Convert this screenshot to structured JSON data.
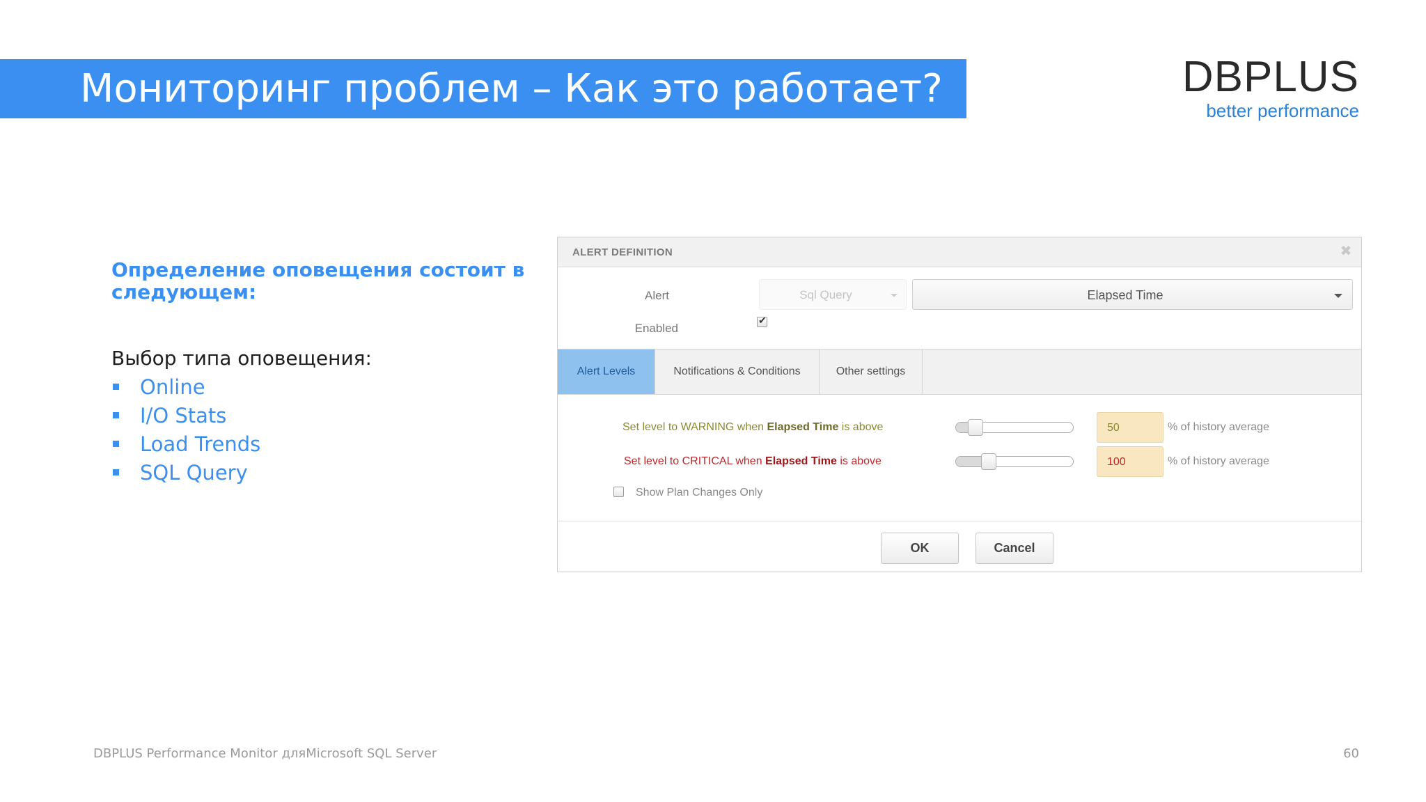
{
  "slide": {
    "title": "Мониторинг проблем – Как это работает?",
    "logo_main": "DBPLUS",
    "logo_sub": "better performance",
    "lead": "Определение оповещения состоит в следующем:",
    "choice_title": "Выбор типа оповещения:",
    "bullets": [
      "Online",
      "I/O Stats",
      "Load Trends",
      "SQL Query"
    ],
    "footer": "DBPLUS Performance Monitor дляMicrosoft SQL Server",
    "page_number": "60",
    "accent_color": "#3a8ff0"
  },
  "dialog": {
    "title": "ALERT DEFINITION",
    "close_icon": "close-icon",
    "alert_label": "Alert",
    "alert_type_value": "Sql Query",
    "alert_metric_value": "Elapsed Time",
    "enabled_label": "Enabled",
    "enabled_checked": true,
    "tabs": [
      {
        "label": "Alert Levels",
        "active": true
      },
      {
        "label": "Notifications & Conditions",
        "active": false
      },
      {
        "label": "Other settings",
        "active": false
      }
    ],
    "warning": {
      "prefix": "Set level to WARNING when ",
      "metric": "Elapsed Time",
      "suffix": " is above",
      "value": "50",
      "unit": "% of history average",
      "slider_fraction": 0.12
    },
    "critical": {
      "prefix": "Set level to CRITICAL when ",
      "metric": "Elapsed Time",
      "suffix": " is above",
      "value": "100",
      "unit": "% of history average",
      "slider_fraction": 0.25
    },
    "show_plan_label": "Show Plan Changes Only",
    "show_plan_checked": false,
    "ok_label": "OK",
    "cancel_label": "Cancel"
  }
}
